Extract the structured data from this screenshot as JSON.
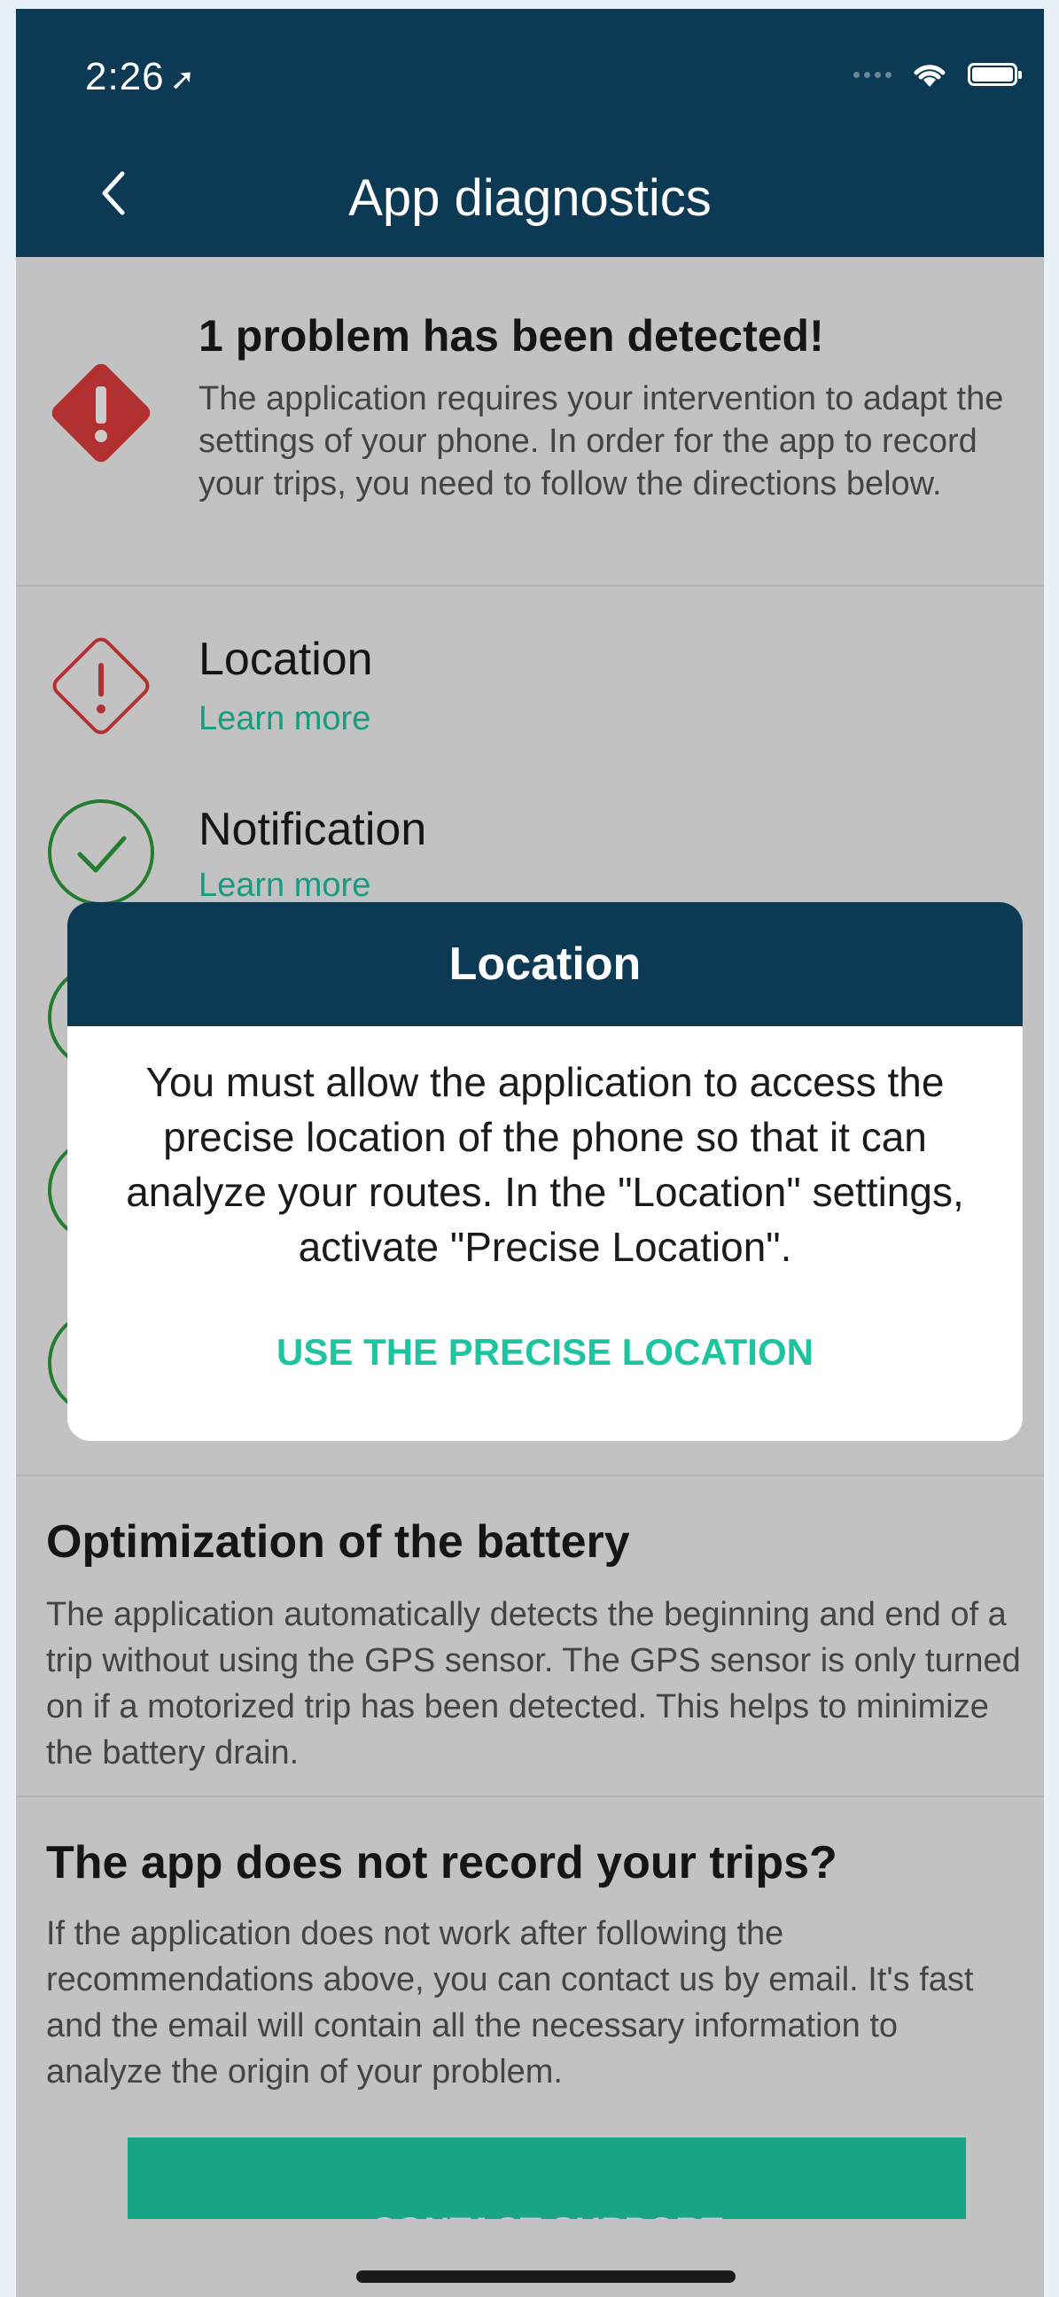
{
  "status_bar": {
    "time": "2:26",
    "location_arrow": "➤"
  },
  "header": {
    "title": "App diagnostics",
    "back_icon": "chevron-left-icon"
  },
  "problem": {
    "title": "1 problem has been detected!",
    "description": "The application requires your intervention to adapt the settings of your phone. In order for the app to record your trips, you need to follow the directions below."
  },
  "checks": [
    {
      "label": "Location",
      "link": "Learn more",
      "status": "error"
    },
    {
      "label": "Notification",
      "link": "Learn more",
      "status": "ok"
    }
  ],
  "battery_section": {
    "title": "Optimization of the battery",
    "text": "The application automatically detects the beginning and end of a trip without using the GPS sensor. The GPS sensor is only turned on if a motorized trip has been detected. This helps to minimize the battery drain."
  },
  "trips_section": {
    "title": "The app does not record your trips?",
    "text": "If the application does not work after following the recommendations above, you can contact us by email. It's fast and the email will contain all the necessary information to analyze the origin of your problem."
  },
  "support_button": {
    "label": "CONTACT SUPPORT"
  },
  "modal": {
    "title": "Location",
    "body": "You must allow the application to access the precise location of the phone so that it can analyze your routes. In the \"Location\" settings, activate \"Precise Location\".",
    "action": "USE THE PRECISE LOCATION"
  },
  "colors": {
    "header_bg": "#0c3954",
    "accent_green": "#1cc4a0",
    "error_red": "#e03c3c",
    "ok_green": "#2e9b3a"
  }
}
